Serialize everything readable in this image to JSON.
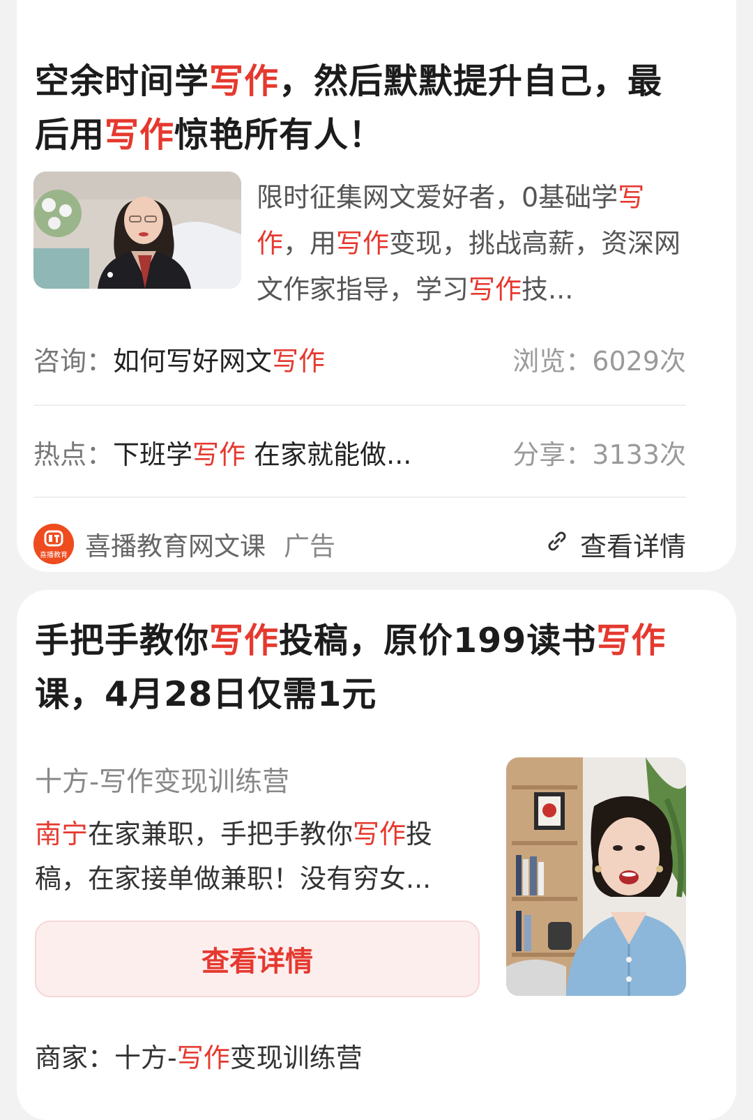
{
  "ad1": {
    "title_parts": [
      "空余时间学",
      "写作",
      "，然后默默提升自己，最后用",
      "写作",
      "惊艳所有人！"
    ],
    "description_parts": [
      "限时征集网文爱好者，0基础学",
      "写作",
      "，用",
      "写作",
      "变现，挑战高薪，资深网文作家指导，学习",
      "写作",
      "技..."
    ],
    "consult_label": "咨询：",
    "consult_text": "如何写好网文",
    "consult_highlight": "写作",
    "views": "浏览：6029次",
    "hot_label": "热点：",
    "hot_text": "下班学",
    "hot_highlight": "写作",
    "hot_rest": " 在家就能做...",
    "shares": "分享：3133次",
    "brand_logo_text": "喜播教育",
    "brand_name": "喜播教育网文课",
    "ad_tag": "广告",
    "detail_link": "查看详情",
    "link_icon": "link-icon",
    "thumbnail": "woman-in-black-blazer-photo"
  },
  "ad2": {
    "title_parts": [
      "手把手教你",
      "写作",
      "投稿，原价199读书",
      "写作",
      "课，4月28日仅需1元"
    ],
    "source": "十方-写作变现训练营",
    "description_parts": [
      "南宁",
      "在家兼职，手把手教你",
      "写作",
      "投稿，在家接单做兼职！没有穷女..."
    ],
    "button_label": "查看详情",
    "merchant_label": "商家：",
    "merchant_prefix": "十方-",
    "merchant_highlight": "写作",
    "merchant_suffix": "变现训练营",
    "thumbnail": "woman-in-blue-cardigan-photo"
  },
  "colors": {
    "highlight": "#e5392f",
    "brand_logo": "#ee4b1f",
    "button_bg": "#fdeeee"
  }
}
